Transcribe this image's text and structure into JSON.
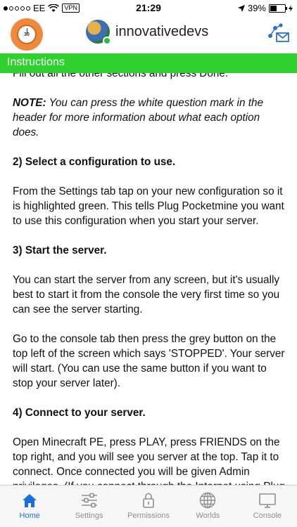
{
  "status_bar": {
    "carrier": "EE",
    "vpn": "VPN",
    "time": "21:29",
    "battery": "39%",
    "battery_level": 0.39
  },
  "header": {
    "timer_number": "30",
    "username": "innovativedevs"
  },
  "section": {
    "title": "Instructions"
  },
  "content": {
    "cut_line": "Fill out all the other sections and press Done.",
    "note_label": "NOTE:",
    "note_text": " You can press the white question mark in the header for more information about what each option does.",
    "step2_heading": "2) Select a configuration to use.",
    "step2_text": "From the Settings tab tap on your new configuration so it is highlighted green.  This tells Plug Pocketmine you want to use this configuration when you start your server.",
    "step3_heading": "3) Start the server.",
    "step3_text1": "You can start the server from any screen, but it's usually best to start it from the console the very first time so you can see the server starting.",
    "step3_text2": "Go to the console tab then press the grey button on the top left of the screen which says 'STOPPED'.  Your server will start. (You can use the same button if you want to stop your server later).",
    "step4_heading": "4) Connect to your server.",
    "step4_text": "Open Minecraft PE, press PLAY, press FRIENDS on the top right, and you will see you server at the top. Tap it to connect.  Once connected you will be given Admin privileges.  (If you connect through the Internet using Plug PE you will be given default privileges).  See more about permissions further down this page."
  },
  "tabs": [
    {
      "label": "Home",
      "icon": "home-icon"
    },
    {
      "label": "Settings",
      "icon": "sliders-icon"
    },
    {
      "label": "Permissions",
      "icon": "lock-icon"
    },
    {
      "label": "Worlds",
      "icon": "globe-icon"
    },
    {
      "label": "Console",
      "icon": "monitor-icon"
    }
  ],
  "colors": {
    "accent_green": "#2fd12f",
    "active_tab": "#1a6fdf",
    "inactive_tab": "#8e8e8e"
  }
}
